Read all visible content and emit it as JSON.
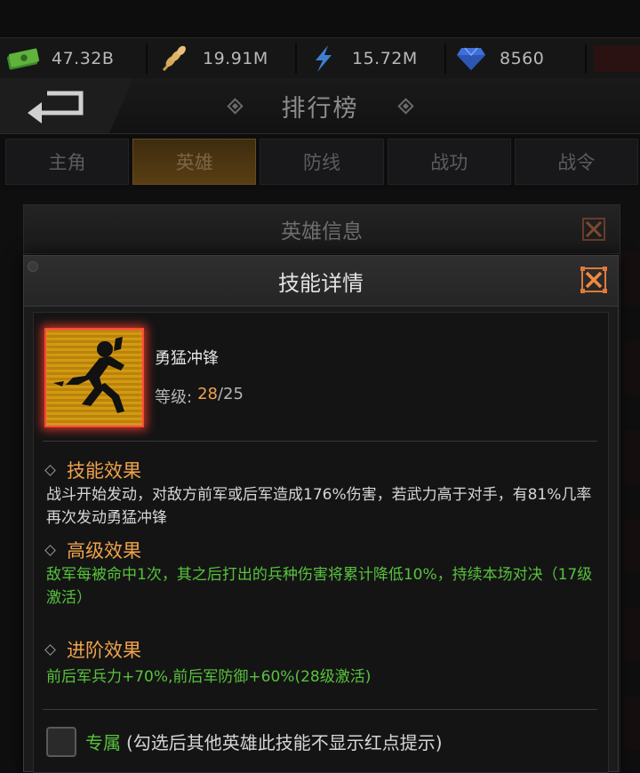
{
  "resources": [
    {
      "icon": "cash-icon",
      "value": "47.32B"
    },
    {
      "icon": "wheat-icon",
      "value": "19.91M"
    },
    {
      "icon": "lightning-icon",
      "value": "15.72M"
    },
    {
      "icon": "diamond-icon",
      "value": "8560"
    }
  ],
  "header": {
    "title": "排行榜"
  },
  "tabs": [
    {
      "label": "主角",
      "active": false
    },
    {
      "label": "英雄",
      "active": true
    },
    {
      "label": "防线",
      "active": false
    },
    {
      "label": "战功",
      "active": false
    },
    {
      "label": "战令",
      "active": false
    }
  ],
  "hero_dialog": {
    "title": "英雄信息"
  },
  "skill_dialog": {
    "title": "技能详情",
    "skill_name": "勇猛冲锋",
    "level_label": "等级:",
    "level_current": "28",
    "level_max": "/25",
    "effect_title": "技能效果",
    "effect_desc": "战斗开始发动，对敌方前军或后军造成176%伤害，若武力高于对手，有81%几率再次发动勇猛冲锋",
    "advanced_title": "高级效果",
    "advanced_desc": "敌军每被命中1次，其之后打出的兵种伤害将累计降低10%，持续本场对决（17级激活）",
    "promote_title": "进阶效果",
    "promote_desc": "前后军兵力+70%,前后军防御+60%(28级激活)",
    "exclusive_label": "专属",
    "exclusive_note": "(勾选后其他英雄此技能不显示红点提示)",
    "exclusive_checked": false
  },
  "colors": {
    "accent": "#f0a24a",
    "green": "#58c23c",
    "icon_border": "#ff4a3a"
  }
}
